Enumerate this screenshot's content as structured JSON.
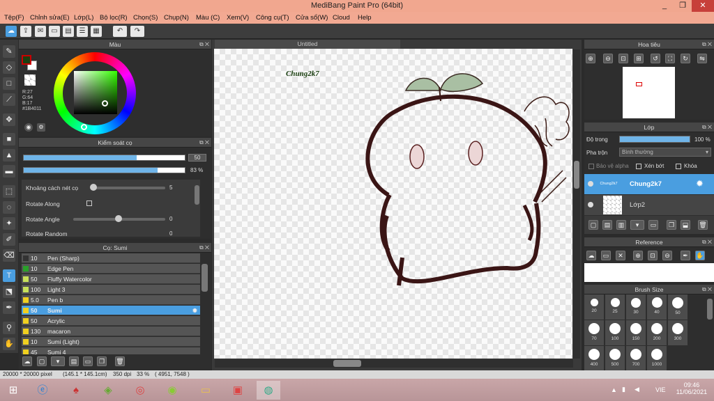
{
  "title": "MediBang Paint Pro (64bit)",
  "window_controls": [
    "_",
    "❐",
    "✕"
  ],
  "menu": [
    "Tệp(F)",
    "Chỉnh sửa(E)",
    "Lớp(L)",
    "Bộ lọc(R)",
    "Chọn(S)",
    "Chụp(N)",
    "Màu (C)",
    "Xem(V)",
    "Công cụ(T)",
    "Cửa sổ(W)",
    "Cloud",
    "Help"
  ],
  "color_panel": {
    "title": "Màu",
    "rgb_r": "R:27",
    "rgb_g": "G:64",
    "rgb_b": "B:17",
    "hex": "#1B4011",
    "fg_color": "#1b4011"
  },
  "brush_control": {
    "title": "Kiểm soát cọ",
    "size_value": "50",
    "opacity_value": "83 %",
    "size_fraction": 0.7,
    "opacity_fraction": 0.83,
    "spacing_label": "Khoảng cách nét cọ",
    "spacing_value": "5",
    "rotate_along_label": "Rotate Along",
    "rotate_angle_label": "Rotate Angle",
    "rotate_angle_value": "0",
    "rotate_random_label": "Rotate Random",
    "rotate_random_value": "0"
  },
  "brush_list": {
    "title": "Cọ: Sumi",
    "items": [
      {
        "size": "10",
        "name": "Pen (Sharp)",
        "color": "#333333"
      },
      {
        "size": "10",
        "name": "Edge Pen",
        "color": "#2aa02a"
      },
      {
        "size": "50",
        "name": "Fluffy Watercolor",
        "color": "#c8e05a"
      },
      {
        "size": "100",
        "name": "Light 3",
        "color": "#c8e05a"
      },
      {
        "size": "5.0",
        "name": "Pen b",
        "color": "#f0d020"
      },
      {
        "size": "50",
        "name": "Sumi",
        "color": "#f0d020"
      },
      {
        "size": "50",
        "name": "Acrylic",
        "color": "#f0d020"
      },
      {
        "size": "130",
        "name": "macaron",
        "color": "#f0d020"
      },
      {
        "size": "10",
        "name": "Sumi (Light)",
        "color": "#f0d020"
      },
      {
        "size": "45",
        "name": "Sumi 4",
        "color": "#f0d020"
      }
    ]
  },
  "canvas": {
    "tab_title": "Untitled",
    "text_layer": "Chung2k7"
  },
  "navigator": {
    "title": "Hoa tiêu"
  },
  "layers": {
    "title": "Lớp",
    "opacity_label": "Độ trong",
    "opacity_value": "100 %",
    "blend_label": "Pha trộn",
    "blend_value": "Bình thường",
    "protect_alpha": "Bảo vệ alpha",
    "clipping": "Xén bớt",
    "lock": "Khóa",
    "items": [
      {
        "name": "Chung2k7",
        "thumb": "Chung2k7"
      },
      {
        "name": "Lớp2",
        "thumb": ""
      }
    ]
  },
  "reference": {
    "title": "Reference"
  },
  "brush_size": {
    "title": "Brush Size",
    "sizes": [
      "20",
      "25",
      "30",
      "40",
      "50",
      "70",
      "100",
      "150",
      "200",
      "300",
      "400",
      "500",
      "700",
      "1000"
    ]
  },
  "status": {
    "dims": "20000 * 20000 pixel",
    "cm": "(145.1 * 145.1cm)",
    "dpi": "350 dpi",
    "zoom": "33 %",
    "coords": "( 4951, 7548 )"
  },
  "taskbar": {
    "lang": "VIE",
    "time": "09:46",
    "date": "11/06/2021"
  }
}
